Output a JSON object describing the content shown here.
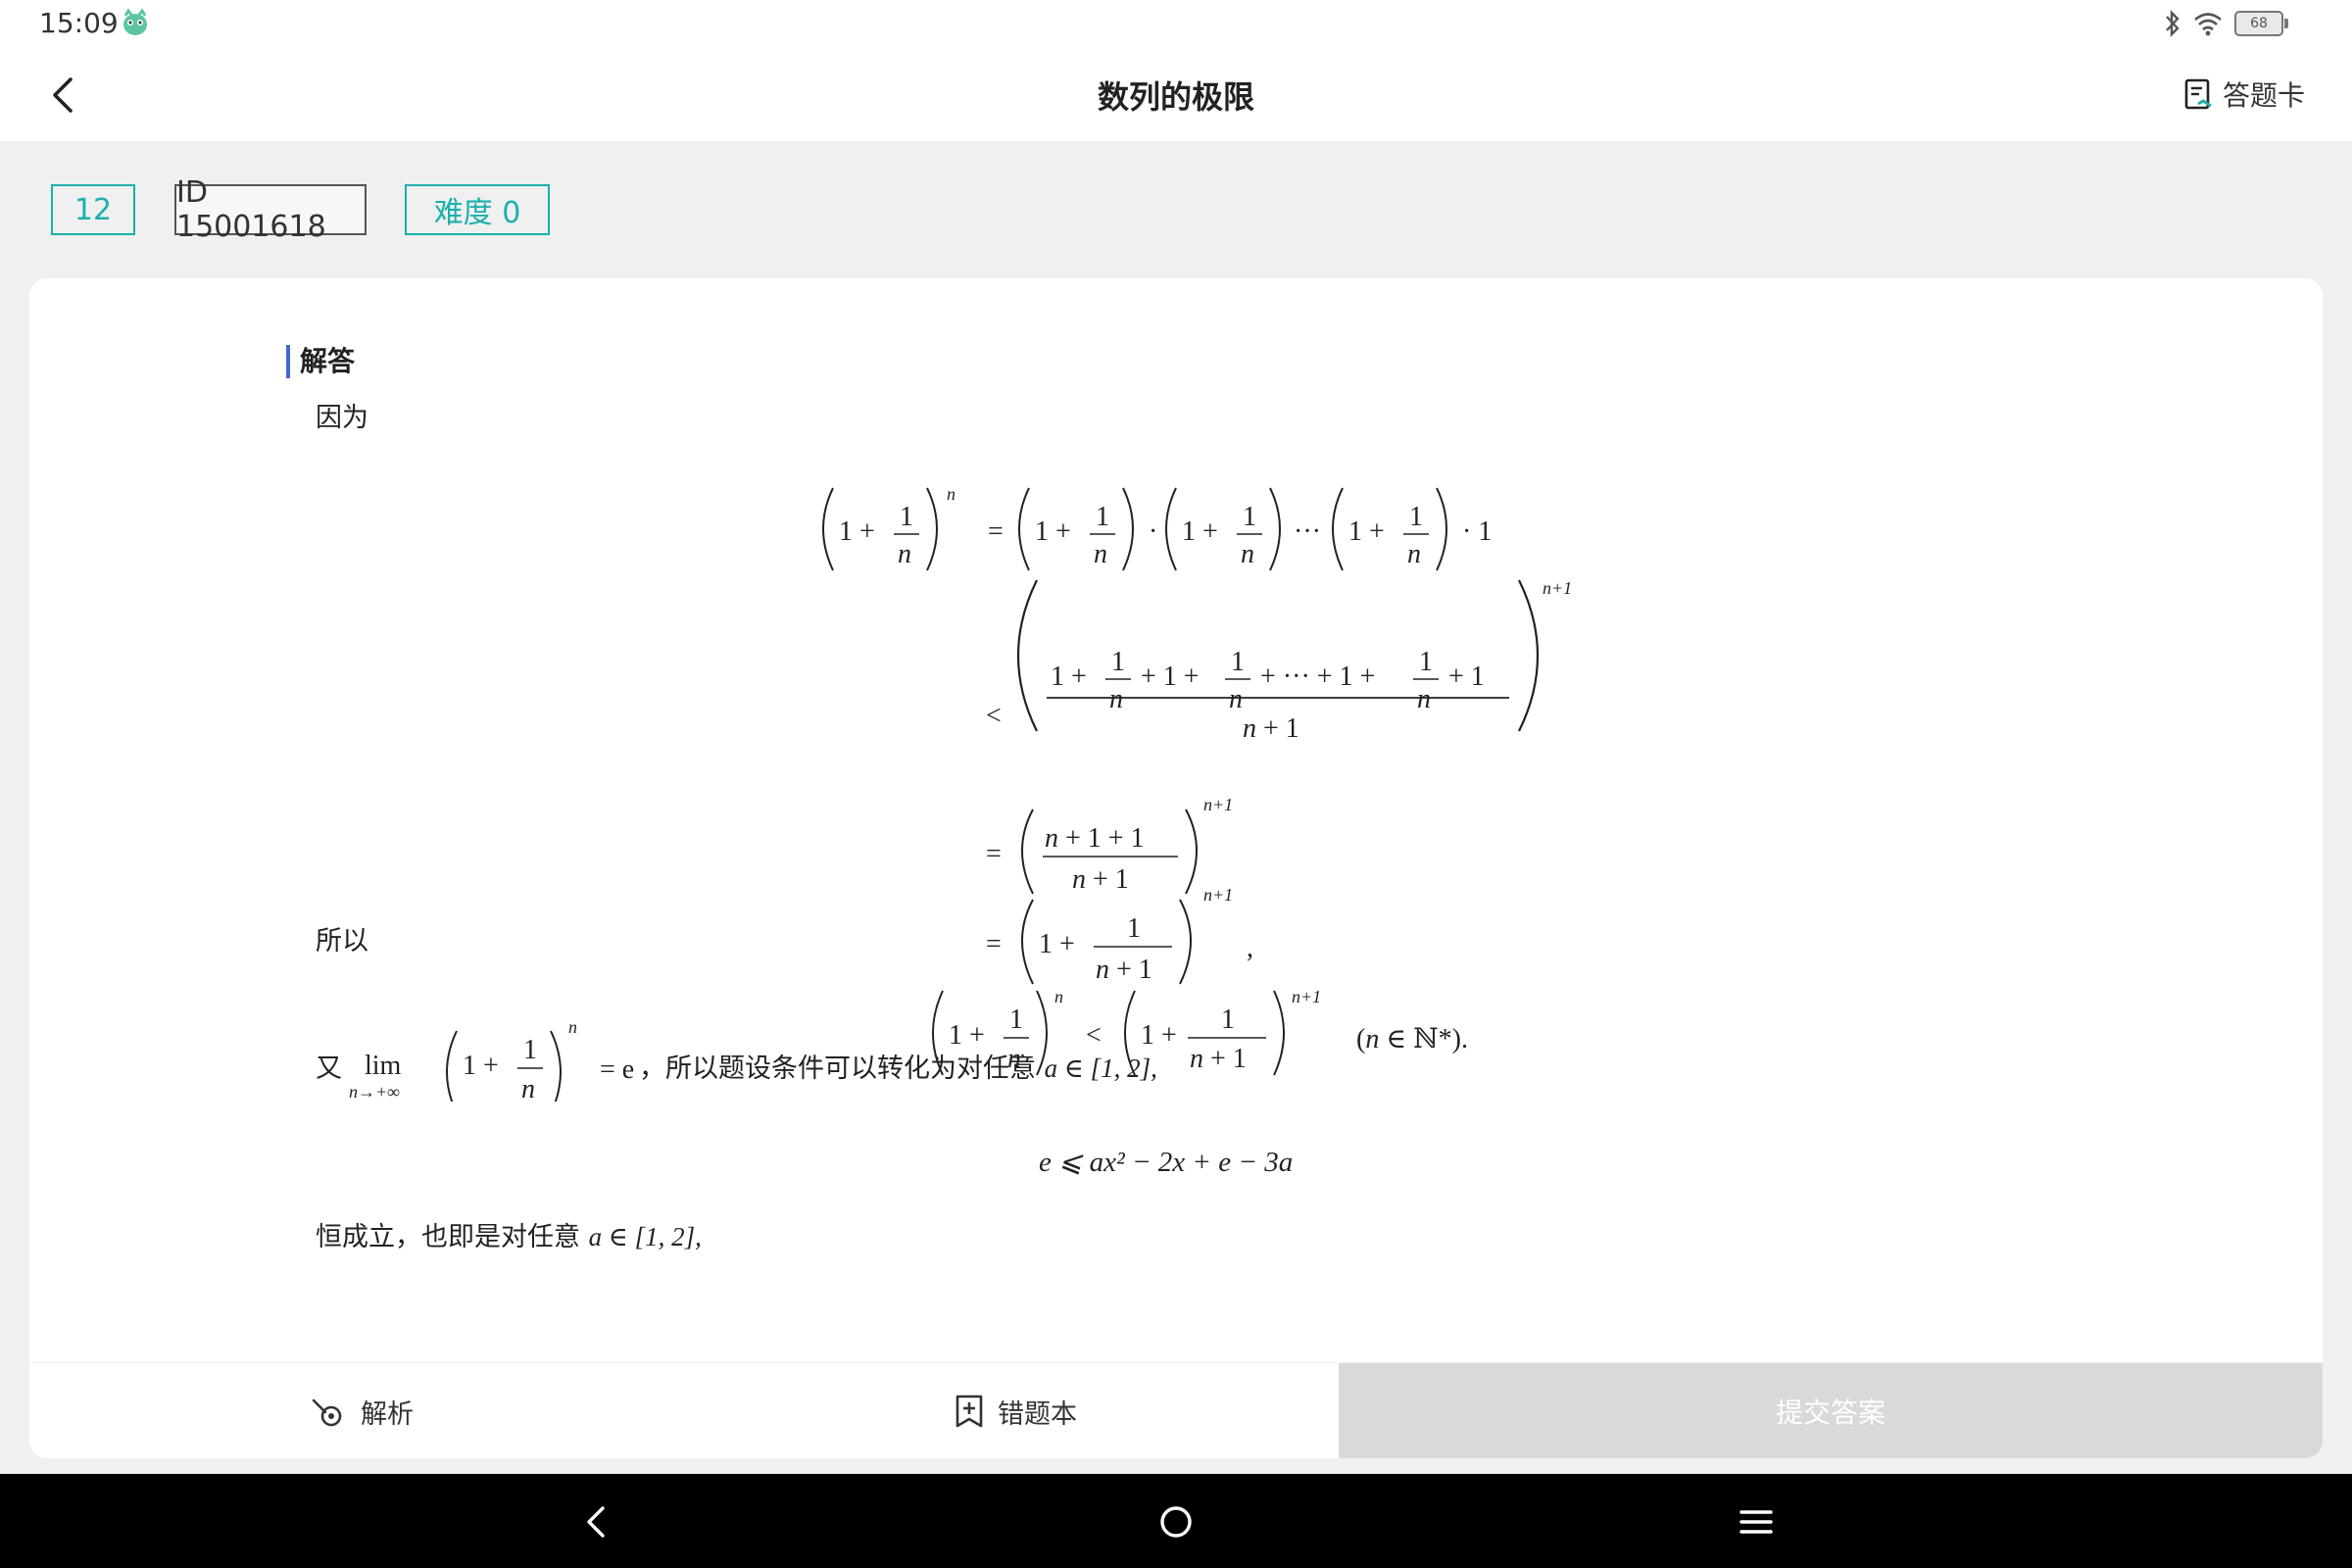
{
  "status": {
    "time": "15:09",
    "battery": "68"
  },
  "header": {
    "title": "数列的极限",
    "answer_card_label": "答题卡"
  },
  "tags": {
    "number": "12",
    "id": "ID 15001618",
    "difficulty": "难度 0"
  },
  "solution": {
    "section_title": "解答",
    "p1": "因为",
    "p2": "所以",
    "p3_prefix": "又",
    "p3_suffix": "，所以题设条件可以转化为对任意",
    "p3_interval": "a ∈ [1, 2],",
    "eq_line": "e ⩽ ax² − 2x + e − 3a",
    "p4": "恒成立，也即是对任意",
    "p4_interval": "a ∈ [1, 2],"
  },
  "bottom_bar": {
    "analysis_label": "解析",
    "wrongbook_label": "错题本",
    "submit_label": "提交答案"
  },
  "colors": {
    "accent": "#1bb0ad",
    "section_bar": "#3f6ad8",
    "submit_bg": "#d9d9d9"
  }
}
